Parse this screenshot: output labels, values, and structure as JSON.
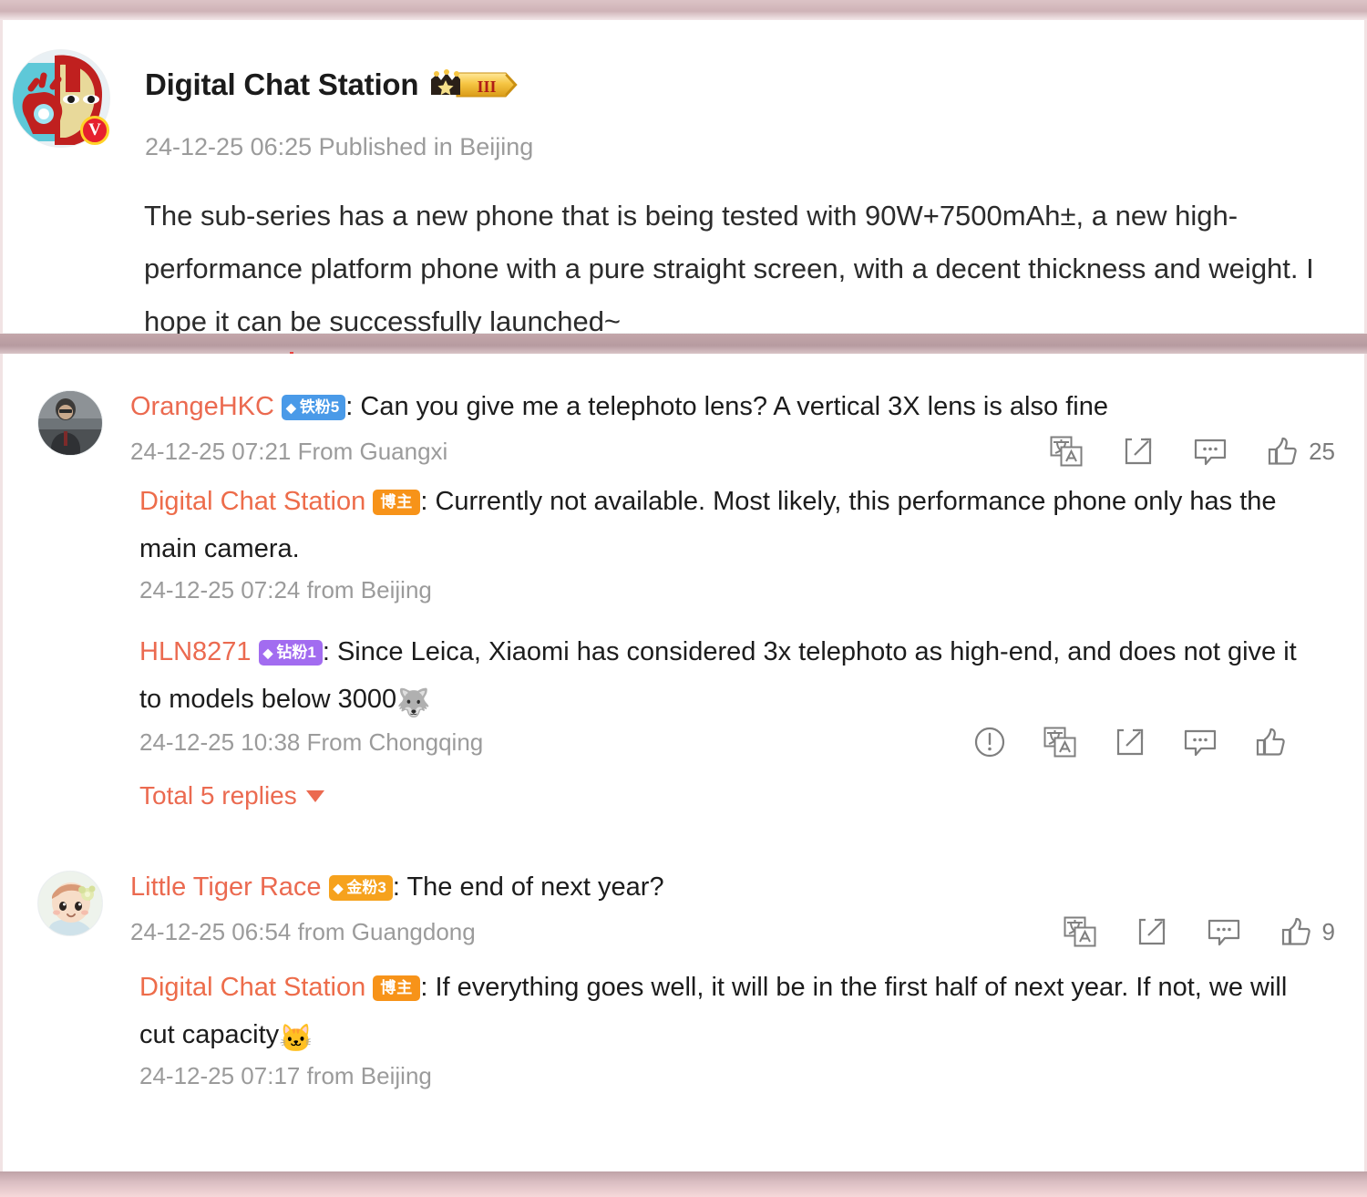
{
  "colors": {
    "accent_orange": "#eb6a50",
    "blogger_badge": "#f79319",
    "iron_fan_badge": "#4a9ae8",
    "gold_fan_badge": "#f6a21d",
    "diamond_fan_badge": "#a26cf0",
    "verified_badge": "#e6202e",
    "frame_band": "#c3a6aa",
    "muted_text": "#9b9b9b"
  },
  "post": {
    "author": "Digital Chat Station",
    "level_badge": "III",
    "verified_mark": "V",
    "meta": "24-12-25 06:25 Published in Beijing",
    "body": "The sub-series has a new phone that is being tested with 90W+7500mAh±, a new high-performance platform phone with a pure straight screen, with a decent thickness and weight. I hope it can be successfully launched~"
  },
  "comments": [
    {
      "author": "OrangeHKC",
      "badge": {
        "label": "铁粉5",
        "type": "iron"
      },
      "separator": ": ",
      "text": "Can you give me a telephoto lens? A vertical 3X lens is also fine",
      "meta": "24-12-25 07:21 From Guangxi",
      "actions": {
        "translate_icon": "translate-icon",
        "share_icon": "share-icon",
        "comment_icon": "comment-icon",
        "like_icon": "like-icon",
        "like_count": "25"
      },
      "replies": [
        {
          "author": "Digital Chat Station",
          "badge": {
            "label": "博主",
            "type": "blogger"
          },
          "separator": ": ",
          "text": "Currently not available. Most likely, this performance phone only has the main camera.",
          "meta": "24-12-25 07:24 from Beijing",
          "actions": null
        },
        {
          "author": "HLN8271",
          "badge": {
            "label": "钻粉1",
            "type": "diamond"
          },
          "separator": ": ",
          "text": "Since Leica, Xiaomi has considered 3x telephoto as high-end, and does not give it to models below 3000",
          "emoji": "🐺",
          "meta": "24-12-25 10:38 From Chongqing",
          "actions": {
            "report_icon": "report-icon",
            "translate_icon": "translate-icon",
            "share_icon": "share-icon",
            "comment_icon": "comment-icon",
            "like_icon": "like-icon",
            "like_count": ""
          }
        }
      ],
      "total_replies_label": "Total 5 replies"
    },
    {
      "author": "Little Tiger Race",
      "badge": {
        "label": "金粉3",
        "type": "gold"
      },
      "separator": ": ",
      "text": "The end of next year?",
      "meta": "24-12-25 06:54 from Guangdong",
      "actions": {
        "translate_icon": "translate-icon",
        "share_icon": "share-icon",
        "comment_icon": "comment-icon",
        "like_icon": "like-icon",
        "like_count": "9"
      },
      "replies": [
        {
          "author": "Digital Chat Station",
          "badge": {
            "label": "博主",
            "type": "blogger"
          },
          "separator": ": ",
          "text": "If everything goes well, it will be in the first half of next year. If not, we will cut capacity",
          "emoji": "🐱",
          "meta": "24-12-25 07:17 from Beijing",
          "actions": null
        }
      ],
      "total_replies_label": ""
    }
  ]
}
